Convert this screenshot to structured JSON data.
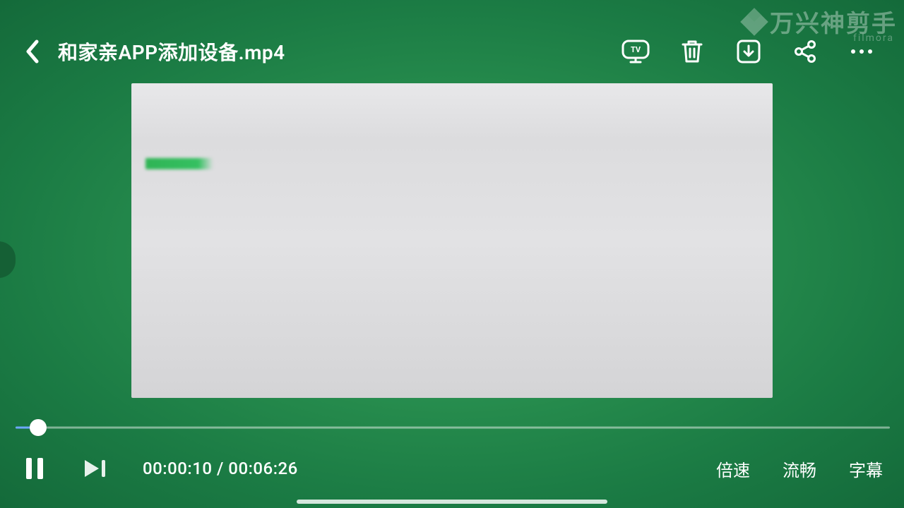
{
  "watermark": {
    "brand": "万兴神剪手",
    "subtext": "filmora"
  },
  "header": {
    "title": "和家亲APP添加设备.mp4",
    "icons": {
      "cast": "cast-icon",
      "delete": "trash-icon",
      "download": "download-icon",
      "share": "share-icon",
      "more": "more-icon"
    }
  },
  "playback": {
    "current_time": "00:00:10",
    "separator": " / ",
    "total_time": "00:06:26",
    "progress_percent": 2.6
  },
  "controls": {
    "pause_label": "pause",
    "next_label": "next",
    "speed": "倍速",
    "quality": "流畅",
    "subtitle": "字幕"
  },
  "colors": {
    "accent_green": "#2fb455",
    "bg_dark": "#1b7b44",
    "bg_light": "#3aa864"
  }
}
